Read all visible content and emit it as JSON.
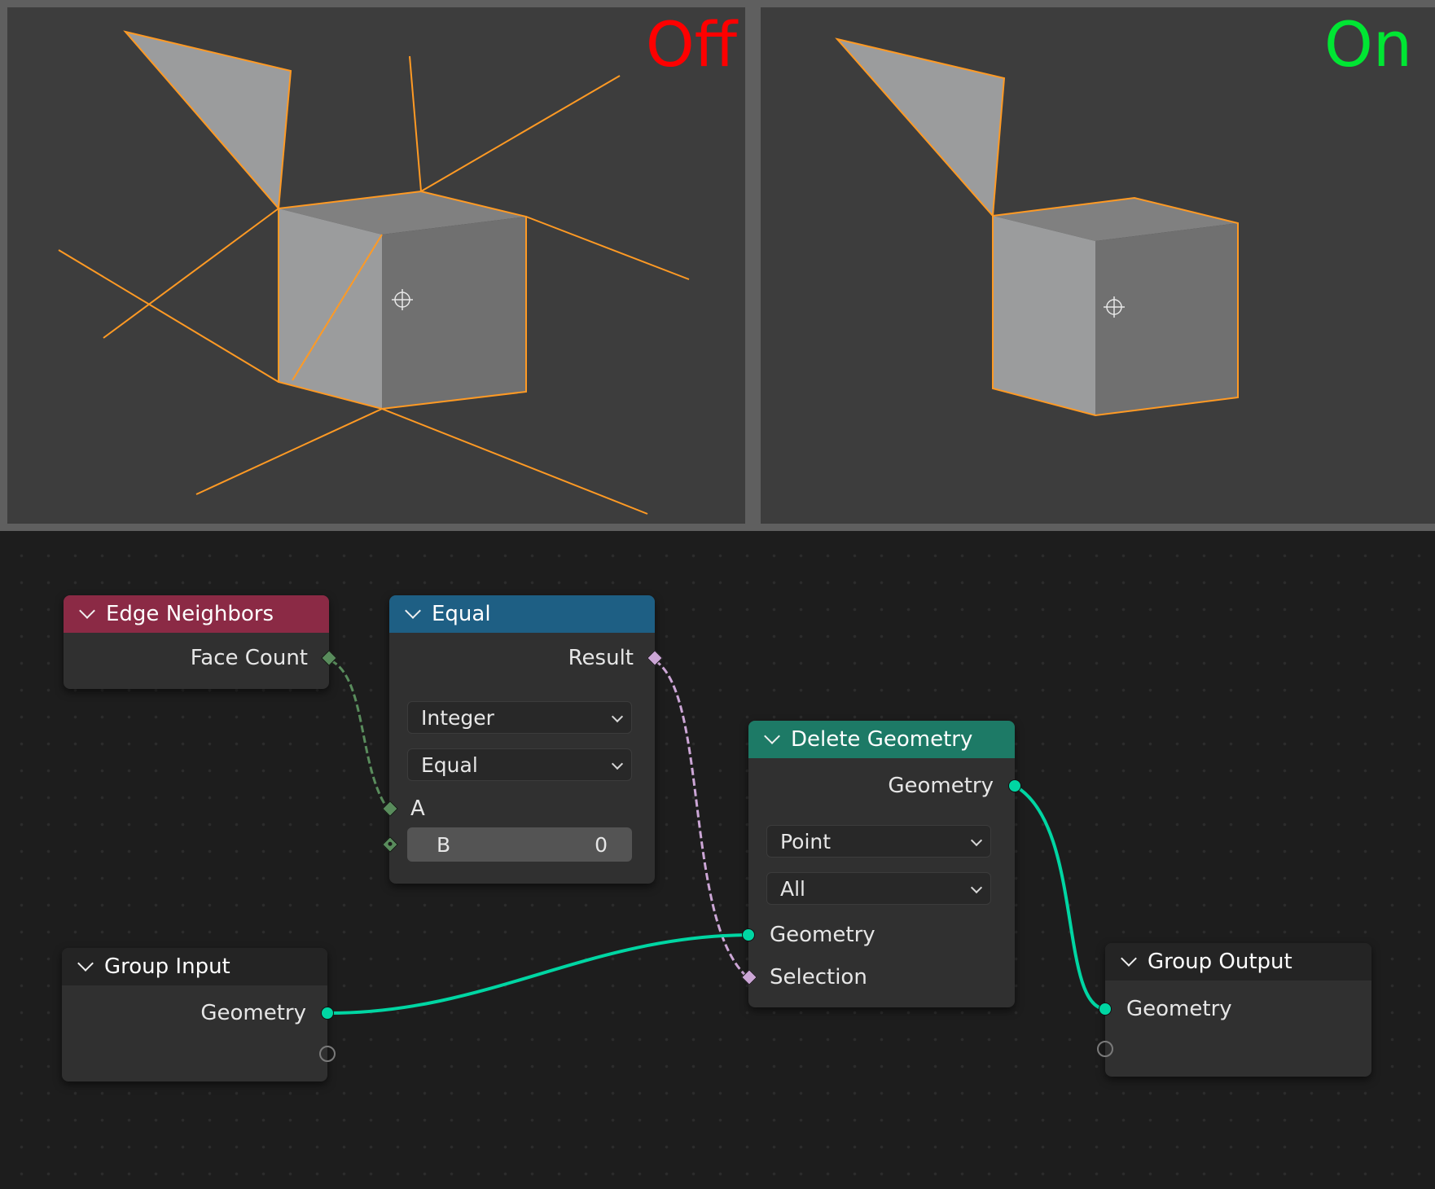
{
  "viewports": {
    "left_label": "Off",
    "right_label": "On",
    "left_label_color": "#ff0000",
    "right_label_color": "#00e633",
    "wire_color": "#ff9a24",
    "face_light": "#9b9c9d",
    "face_mid": "#808080",
    "face_dark": "#707070"
  },
  "nodes": {
    "edge_neighbors": {
      "title": "Edge Neighbors",
      "header_color": "#8b2a45",
      "output_face_count": "Face Count"
    },
    "equal": {
      "title": "Equal",
      "header_color": "#1e5f84",
      "output_result": "Result",
      "data_type": "Integer",
      "operation": "Equal",
      "input_a": "A",
      "input_b_label": "B",
      "input_b_value": "0"
    },
    "delete_geometry": {
      "title": "Delete Geometry",
      "header_color": "#1d7a66",
      "output_geometry": "Geometry",
      "domain": "Point",
      "mode": "All",
      "input_geometry": "Geometry",
      "input_selection": "Selection"
    },
    "group_input": {
      "title": "Group Input",
      "header_color": "#242424",
      "output_geometry": "Geometry"
    },
    "group_output": {
      "title": "Group Output",
      "header_color": "#242424",
      "input_geometry": "Geometry"
    }
  },
  "socket_colors": {
    "geometry": "#00d6a3",
    "integer": "#598c5c",
    "boolean": "#cca6d6"
  }
}
